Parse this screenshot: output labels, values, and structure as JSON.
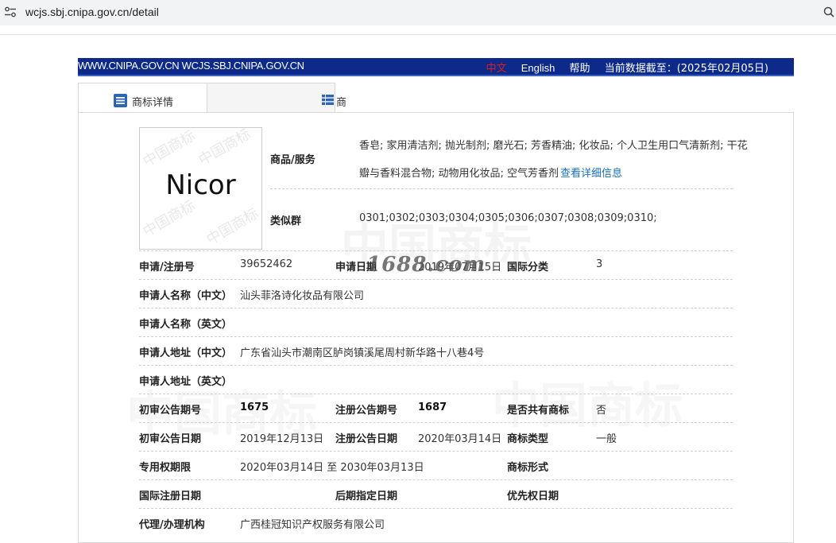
{
  "browser": {
    "url": "wcjs.sbj.cnipa.gov.cn/detail"
  },
  "topbar": {
    "sites": "WWW.CNIPA.GOV.CN WCJS.SBJ.CNIPA.GOV.CN",
    "lang_zh": "中文",
    "lang_en": "English",
    "help": "帮助",
    "data_date": "当前数据截至：(2025年02月05日)",
    "accent_color": "#0d2a8a"
  },
  "tabs": [
    {
      "label": "商标详情",
      "icon": "list-icon",
      "active": true
    },
    {
      "label": "商标流程",
      "icon": "table-icon",
      "active": false
    }
  ],
  "logo": {
    "text": "Nicor",
    "watermark": "中国商标"
  },
  "watermark_text": "中国商标",
  "stamp": "1688.com",
  "goods": {
    "label": "商品/服务",
    "line1": "香皂; 家用清洁剂; 抛光制剂; 磨光石; 芳香精油; 化妆品; 个人卫生用口气清新剂; 干花",
    "line2": "瓣与香料混合物; 动物用化妆品; 空气芳香剂",
    "more_link": "查看详细信息"
  },
  "similar_group": {
    "label": "类似群",
    "value": "0301;0302;0303;0304;0305;0306;0307;0308;0309;0310;"
  },
  "rows": {
    "reg_no_label": "申请/注册号",
    "reg_no": "39652462",
    "apply_date_label": "申请日期",
    "apply_date": "2019年07月15日",
    "intl_class_label": "国际分类",
    "intl_class": "3",
    "applicant_cn_label": "申请人名称（中文）",
    "applicant_cn": "汕头菲洛诗化妆品有限公司",
    "applicant_en_label": "申请人名称（英文）",
    "applicant_en": "",
    "address_cn_label": "申请人地址（中文）",
    "address_cn": "广东省汕头市潮南区胪岗镇溪尾周村新华路十八巷4号",
    "address_en_label": "申请人地址（英文）",
    "address_en": "",
    "prelim_no_label": "初审公告期号",
    "prelim_no": "1675",
    "reg_notice_no_label": "注册公告期号",
    "reg_notice_no": "1687",
    "shared_label": "是否共有商标",
    "shared": "否",
    "prelim_date_label": "初审公告日期",
    "prelim_date": "2019年12月13日",
    "reg_notice_date_label": "注册公告日期",
    "reg_notice_date": "2020年03月14日",
    "tm_type_label": "商标类型",
    "tm_type": "一般",
    "exclusive_label": "专用权期限",
    "exclusive": "2020年03月14日 至 2030年03月13日",
    "tm_form_label": "商标形式",
    "tm_form": "",
    "intl_reg_date_label": "国际注册日期",
    "later_date_label": "后期指定日期",
    "priority_date_label": "优先权日期",
    "agent_label": "代理/办理机构",
    "agent": "广西桂冠知识产权服务有限公司"
  }
}
